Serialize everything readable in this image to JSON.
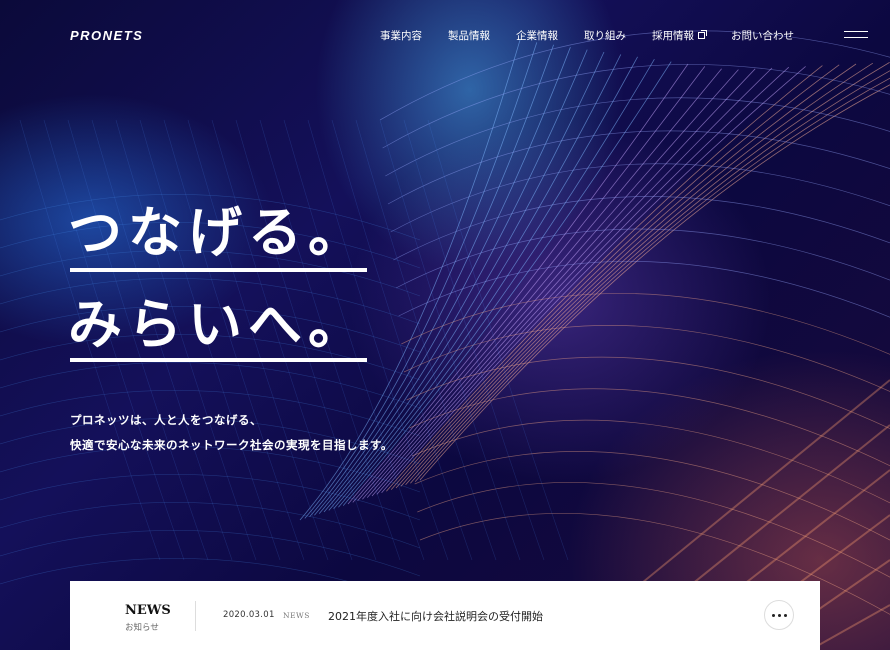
{
  "header": {
    "logo": "PRONETS",
    "nav": [
      {
        "label": "事業内容"
      },
      {
        "label": "製品情報"
      },
      {
        "label": "企業情報"
      },
      {
        "label": "取り組み"
      },
      {
        "label": "採用情報",
        "icon": "external-link-icon"
      },
      {
        "label": "お問い合わせ"
      }
    ],
    "menu_icon": "hamburger-menu-icon"
  },
  "hero": {
    "headline_line1": "つなげる。",
    "headline_line2": "みらいへ。",
    "lead_line1": "プロネッツは、人と人をつなげる、",
    "lead_line2": "快適で安心な未来のネットワーク社会の実現を目指します。"
  },
  "news": {
    "title": "NEWS",
    "subtitle": "お知らせ",
    "date": "2020.03.01",
    "category": "NEWS",
    "headline": "2021年度入社に向け会社説明会の受付開始",
    "more_icon": "more-dots-icon"
  },
  "colors": {
    "background_dark": "#0a0630",
    "text_light": "#ffffff",
    "news_bg": "#ffffff"
  }
}
